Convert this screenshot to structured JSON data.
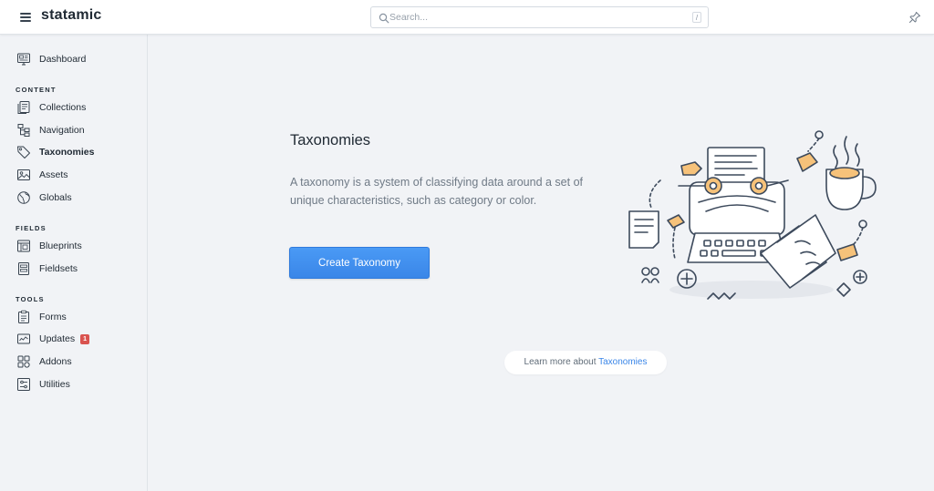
{
  "header": {
    "brand": "statamic",
    "search_placeholder": "Search...",
    "search_shortcut": "/"
  },
  "sidebar": {
    "top": [
      {
        "label": "Dashboard",
        "icon": "dashboard-icon"
      }
    ],
    "sections": [
      {
        "title": "CONTENT",
        "items": [
          {
            "label": "Collections",
            "icon": "collections-icon"
          },
          {
            "label": "Navigation",
            "icon": "navigation-icon"
          },
          {
            "label": "Taxonomies",
            "icon": "tag-icon",
            "active": true
          },
          {
            "label": "Assets",
            "icon": "assets-icon"
          },
          {
            "label": "Globals",
            "icon": "globe-icon"
          }
        ]
      },
      {
        "title": "FIELDS",
        "items": [
          {
            "label": "Blueprints",
            "icon": "blueprints-icon"
          },
          {
            "label": "Fieldsets",
            "icon": "fieldsets-icon"
          }
        ]
      },
      {
        "title": "TOOLS",
        "items": [
          {
            "label": "Forms",
            "icon": "forms-icon"
          },
          {
            "label": "Updates",
            "icon": "updates-icon",
            "badge": "1"
          },
          {
            "label": "Addons",
            "icon": "addons-icon"
          },
          {
            "label": "Utilities",
            "icon": "utilities-icon"
          }
        ]
      }
    ]
  },
  "main": {
    "title": "Taxonomies",
    "description": "A taxonomy is a system of classifying data around a set of unique characteristics, such as category or color.",
    "create_button": "Create Taxonomy",
    "learn_more_prefix": "Learn more about",
    "learn_more_link": "Taxonomies"
  },
  "colors": {
    "accent": "#3a86e8",
    "badge": "#d9534f",
    "illustration_orange": "#f6c27a"
  }
}
